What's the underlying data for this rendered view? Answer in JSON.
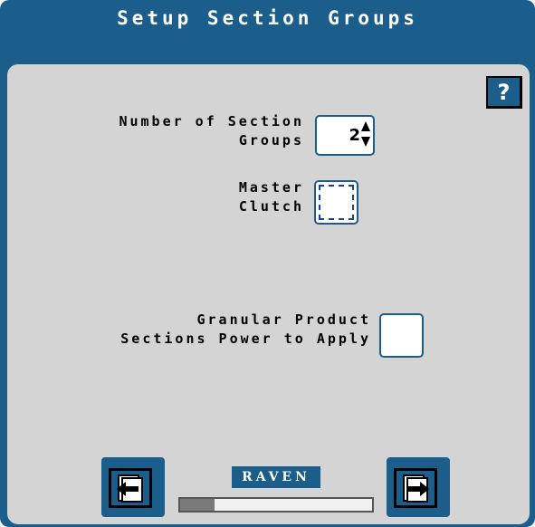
{
  "title": "Setup Section Groups",
  "help": {
    "label": "?",
    "icon": "question-mark-icon"
  },
  "section_groups": {
    "label_line1": "Number of Section",
    "label_line2": "Groups",
    "value": "2"
  },
  "master_clutch": {
    "label_line1": "Master",
    "label_line2": "Clutch",
    "checked": false
  },
  "granular": {
    "label_line1": "Granular Product",
    "label_line2": "Sections Power to Apply",
    "checked": false
  },
  "nav": {
    "back_icon": "page-back-icon",
    "next_icon": "page-next-icon"
  },
  "logo": {
    "text": "RAVEN"
  },
  "progress": {
    "fraction": 0.18
  },
  "colors": {
    "frame": "#1b5e8c",
    "panel": "#d4d4d4"
  }
}
